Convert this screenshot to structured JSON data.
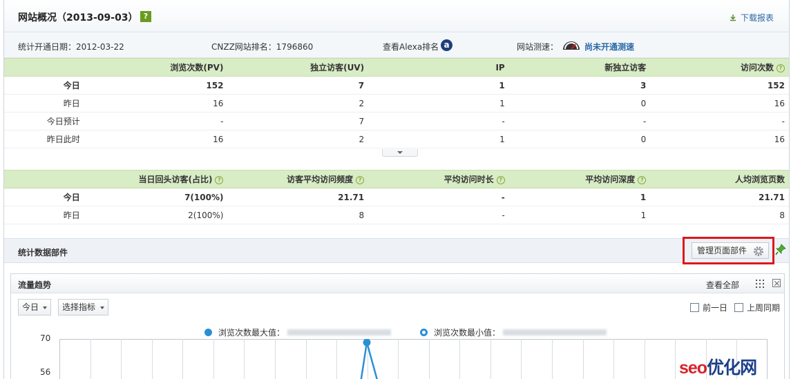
{
  "header": {
    "title": "网站概况（2013-09-03）",
    "help": "?",
    "download": "下载报表"
  },
  "info": {
    "open_date": "统计开通日期：2012-03-22",
    "rank": "CNZZ网站排名：1796860",
    "alexa": "查看Alexa排名",
    "alexa_icon_letter": "a",
    "speed_label": "网站测速：",
    "speed_link": "尚未开通测速"
  },
  "table1": {
    "headers": [
      "",
      "浏览次数(PV)",
      "独立访客(UV)",
      "IP",
      "新独立访客",
      "访问次数"
    ],
    "rows": [
      [
        "今日",
        "152",
        "7",
        "1",
        "3",
        "152"
      ],
      [
        "昨日",
        "16",
        "2",
        "1",
        "0",
        "16"
      ],
      [
        "今日预计",
        "-",
        "7",
        "-",
        "-",
        "-"
      ],
      [
        "昨日此时",
        "16",
        "2",
        "1",
        "0",
        "16"
      ]
    ]
  },
  "table2": {
    "headers": [
      "",
      "当日回头访客(占比)",
      "访客平均访问频度",
      "平均访问时长",
      "平均访问深度",
      "人均浏览页数"
    ],
    "rows": [
      [
        "今日",
        "7(100%)",
        "21.71",
        "-",
        "1",
        "21.71"
      ],
      [
        "昨日",
        "2(100%)",
        "8",
        "-",
        "1",
        "8"
      ]
    ]
  },
  "widgets": {
    "title": "统计数据部件",
    "manage": "管理页面部件"
  },
  "trend": {
    "title": "流量趋势",
    "view_all": "查看全部",
    "range": "今日",
    "metric": "选择指标",
    "prev_day": "前一日",
    "last_week": "上周同期",
    "legend_max": "浏览次数最大值：",
    "legend_min": "浏览次数最小值：",
    "y_ticks": [
      "70",
      "56"
    ],
    "accent": "#2b8fd6"
  },
  "chart_data": {
    "type": "line",
    "ylim": [
      56,
      70
    ],
    "series": [
      {
        "name": "浏览次数",
        "values": []
      }
    ]
  },
  "watermark": {
    "part1": "seo",
    "part2": "优化网"
  }
}
